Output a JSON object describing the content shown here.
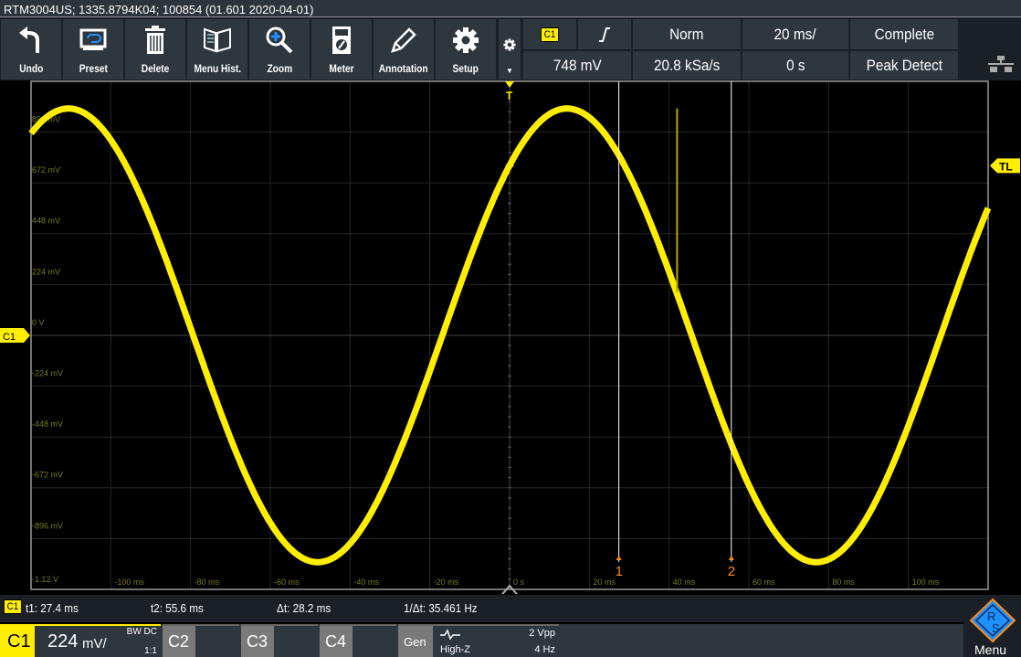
{
  "title": "RTM3004US; 1335.8794K04; 100854 (01.601 2020-04-01)",
  "toolbar": {
    "buttons": [
      {
        "label": "Undo",
        "icon": "undo-icon"
      },
      {
        "label": "Preset",
        "icon": "preset-icon"
      },
      {
        "label": "Delete",
        "icon": "trash-icon"
      },
      {
        "label": "Menu Hist.",
        "icon": "menu-history-icon"
      },
      {
        "label": "Zoom",
        "icon": "zoom-icon"
      },
      {
        "label": "Meter",
        "icon": "meter-icon"
      },
      {
        "label": "Annotation",
        "icon": "pencil-icon"
      },
      {
        "label": "Setup",
        "icon": "gear-icon"
      }
    ]
  },
  "trigger": {
    "source": "C1",
    "slope": "rising-edge-icon",
    "mode": "Norm",
    "level": "748 mV"
  },
  "acquisition": {
    "timebase": "20 ms/",
    "sample_rate": "20.8 kSa/s",
    "position": "0 s",
    "state": "Complete",
    "mode": "Peak Detect"
  },
  "axes": {
    "y_labels": [
      "896 mV",
      "672 mV",
      "448 mV",
      "224 mV",
      "0 V",
      "-224 mV",
      "-448 mV",
      "-672 mV",
      "-896 mV",
      "-1.12 V"
    ],
    "x_labels": [
      "-100 ms",
      "-80 ms",
      "-60 ms",
      "-40 ms",
      "-20 ms",
      "0 s",
      "20 ms",
      "40 ms",
      "60 ms",
      "80 ms",
      "100 ms"
    ],
    "y_range_v": [
      -1.12,
      1.12
    ],
    "x_range_ms": [
      -120,
      120
    ]
  },
  "markers": {
    "trigger": "T",
    "trigger_level": "TL",
    "channel": "C1",
    "cursor1": "1",
    "cursor2": "2"
  },
  "waveform": {
    "color": "#ffee00",
    "amplitude_v": 1.0,
    "period_ms": 125,
    "peak_time_ms": 14.4,
    "glitch_time_ms": 42,
    "glitch_v": [
      0.19,
      1.0
    ]
  },
  "cursors": {
    "channel": "C1",
    "t1": "t1: 27.4 ms",
    "t2": "t2: 55.6 ms",
    "dt": "Δt: 28.2 ms",
    "inv_dt": "1/Δt: 35.461 Hz",
    "t1_ms": 27.4,
    "t2_ms": 55.6
  },
  "channels": {
    "c1": {
      "label": "C1",
      "scale": "224",
      "unit": "mV/",
      "bw": "BW DC",
      "probe": "1:1"
    },
    "c2": "C2",
    "c3": "C3",
    "c4": "C4",
    "gen": {
      "label": "Gen",
      "load": "High-Z",
      "amplitude": "2 Vpp",
      "frequency": "4 Hz"
    }
  },
  "menu": "Menu",
  "colors": {
    "accent": "#ffee00",
    "cursor": "#ff8c1a",
    "panel": "#2e363e"
  }
}
